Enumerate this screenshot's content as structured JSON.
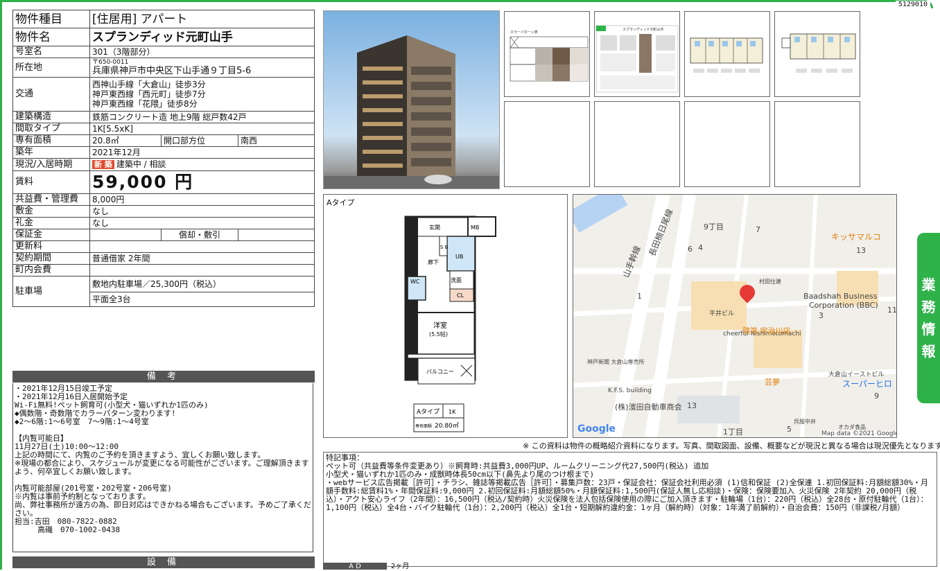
{
  "property_id": "5129010",
  "spec": {
    "type_label": "物件種目",
    "type_value": "[住居用] アパート",
    "name_label": "物件名",
    "name_value": "スプランディッド元町山手",
    "room_label": "号室名",
    "room_value": "301（3階部分）",
    "address_label": "所在地",
    "address_zip": "〒650-0011",
    "address_value": "兵庫県神戸市中央区下山手通９丁目5-6",
    "access_label": "交通",
    "access_lines": [
      "西神山手線「大倉山」徒歩3分",
      "神戸東西線「西元町」徒歩7分",
      "神戸東西線「花隈」徒歩8分"
    ],
    "structure_label": "建築構造",
    "structure_value": "鉄筋コンクリート造 地上9階 総戸数42戸",
    "layout_label": "間取タイプ",
    "layout_value": "1K[5.5xK]",
    "area_label": "専有面積",
    "area_value": "20.8㎡",
    "direction_label": "開口部方位",
    "direction_value": "南西",
    "built_label": "築年",
    "built_value": "2021年12月",
    "status_label": "現況/入居時期",
    "status_badge": "新 築",
    "status_value": "建築中 / 相談",
    "rent_label": "賃料",
    "rent_value": "59,000 円",
    "fee_label": "共益費・管理費",
    "fee_value": "8,000円",
    "deposit_label": "敷金",
    "deposit_value": "なし",
    "key_label": "礼金",
    "key_value": "なし",
    "guarantee_label": "保証金",
    "guarantee_sub": "償却・敷引",
    "renewal_label": "更新料",
    "contract_label": "契約期間",
    "contract_value": "普通借家 2年間",
    "association_label": "町内会費",
    "parking_label": "駐車場",
    "parking_line1": "敷地内駐車場／25,300円（税込）",
    "parking_line2": "平面全3台"
  },
  "remarks": {
    "head": "備 考",
    "text": "・2021年12月15日竣工予定\n・2021年12月16日入居開始予定\nWi-Fi無料!ペット飼育可(小型犬・猫いずれか1匹のみ)\n◆偶数階・奇数階でカラーパターン変わります!\n◆2～6階:1～6号室　7～9階:1～4号室\n\n【内覧可能日】\n11月27日(土)10:00～12:00\n上記の時間にて、内覧のご予約を頂きますよう、宜しくお願い致します。\n※現場の都合により、スケジュールが変更になる可能性がございます。ご理解頂きますよう、何卒宜しくお願い致します。\n\n内覧可能部屋(201号室・202号室・206号室)\n※内覧は事前予約制となっております。\n尚、弊社事務所が遠方の為、即日対応はできかねる場合もございます。予めご了承ください。\n担当:吉田　080-7822-0882\n　　　高磯　070-1002-0438"
  },
  "equipment_head": "設 備",
  "floorplan": {
    "title": "Aタイプ",
    "rooms": {
      "entrance": "玄関",
      "mb": "MB",
      "sb": "S B",
      "hall": "廊下",
      "ub": "UB",
      "wash": "洗面",
      "wc": "WC",
      "cl": "CL",
      "room": "洋室",
      "room_size": "(5.5帖)",
      "balcony": "バルコニー"
    },
    "card_type": "Aタイプ",
    "card_layout": "1K",
    "card_area_label": "専有面積",
    "card_area": "20.80㎡"
  },
  "map": {
    "labels": [
      "9丁目",
      "7",
      "6",
      "4",
      "13",
      "キッサマルコ",
      "村田住建",
      "Baadshah Business",
      "Corporation (BBC)",
      "3",
      "11",
      "1",
      "平井ビル",
      "cheerful Nishimotomachi",
      "鶏笑 宇治川店",
      "神戸新聞 大倉山専売所",
      "大倉山イーストビル",
      "スーパーヒロ",
      "芸夢",
      "9",
      "K.F.S. building",
      "(株)濱田自動車商会",
      "13",
      "1丁目",
      "5",
      "呉服中井",
      "オカダ食品",
      "山手幹線",
      "長田楠日尾線"
    ],
    "google": "Google",
    "attribution": "Map data ©2021 Google"
  },
  "notice": "※ この資料は物件の概略紹介資料になります。写真、間取図面、設備、概要などが現況と異なる場合は現況優先となります。",
  "special": {
    "title": "特記事項：",
    "text": "ペット可（共益費等条件変更あり）※飼育時:共益費3,000円UP、ルームクリーニング代27,500円(税込) 追加\n小型犬・猫いずれか1匹のみ・成獣時体長50cm以下(鼻先より尾のつけ根まで)\n・webサービス広告掲載［許可］・チラシ、雑誌等掲載広告［許可］・募集戸数：23戸・保証会社：保証会社利用必須 (1)信和保証 (2)全保連 1.初回保証料:月額総額30%・月額手数料:総賃料1%・年間保証料:9,000円 2.初回保証料:月額総額50%・月額保証料:1,500円(保証人無し応相談)・保険：保険要加入 火災保険 2年契約 20,000円（税込）・アクト安心ライフ（2年間）：16,500円（税込/契約時）火災保険を法人包括保険使用の際にご加入頂きます・駐輪場（1台）：220円（税込）全28台・原付駐輪代（1台）：1,100円（税込）全4台・バイク駐輪代（1台）：2,200円（税込）全1台・短期解約違約金：1ヶ月（解約時）（対象：1年満了前解約）・自治会費：150円（非課税/月額）"
  },
  "ad": {
    "label": "A D",
    "value": "2ヶ月"
  },
  "side_tab": [
    "業",
    "務",
    "情",
    "報"
  ],
  "thumbs": {
    "color_title": "カラーパターン表",
    "brochure_title": "スプランディッド元町山手"
  },
  "colors": {
    "green": "#2fb24a",
    "red_pin": "#e53935",
    "header_gray": "#555555"
  }
}
